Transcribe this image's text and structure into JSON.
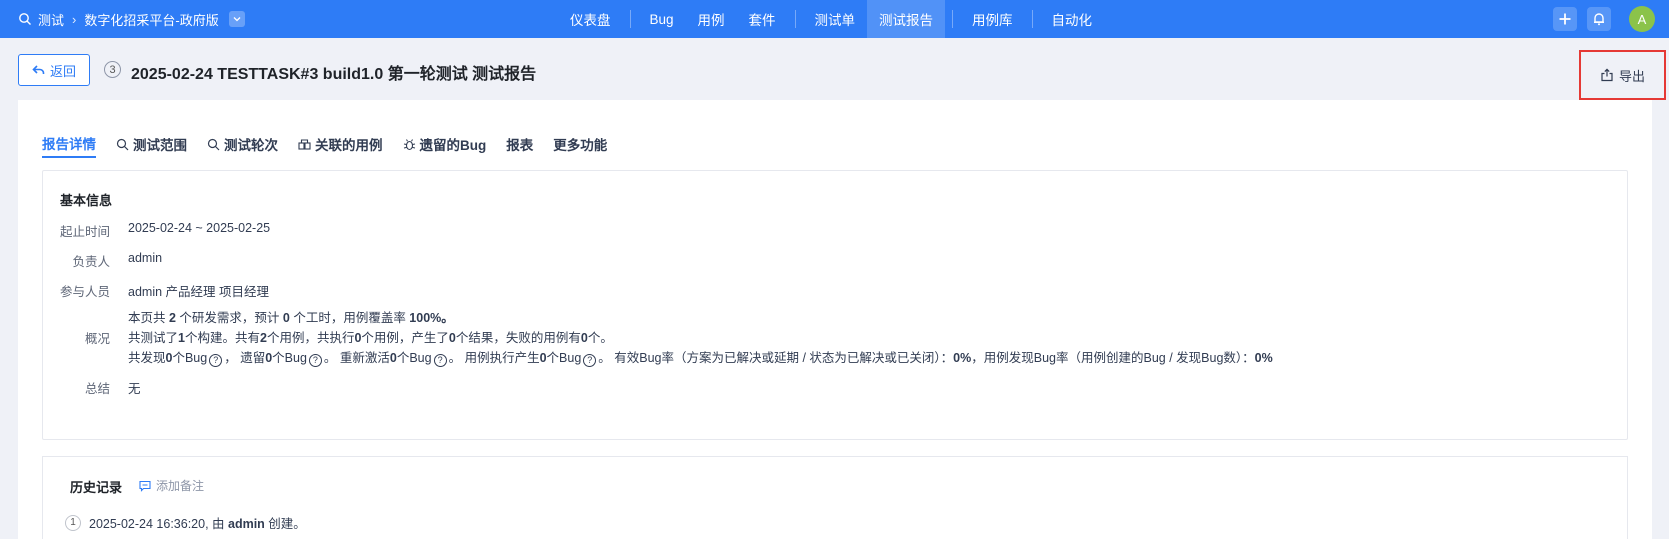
{
  "breadcrumb": {
    "module": "测试",
    "product": "数字化招采平台-政府版"
  },
  "nav": {
    "items": [
      {
        "label": "仪表盘"
      },
      {
        "label": "Bug"
      },
      {
        "label": "用例"
      },
      {
        "label": "套件"
      },
      {
        "label": "测试单"
      },
      {
        "label": "测试报告",
        "active": true
      },
      {
        "label": "用例库"
      },
      {
        "label": "自动化"
      }
    ]
  },
  "user": {
    "avatar_initial": "A"
  },
  "header": {
    "back_label": "返回",
    "report_id": "3",
    "title": "2025-02-24 TESTTASK#3 build1.0 第一轮测试 测试报告",
    "export_label": "导出"
  },
  "tabs": [
    {
      "label": "报告详情",
      "active": true,
      "icon": ""
    },
    {
      "label": "测试范围",
      "icon": "search-icon"
    },
    {
      "label": "测试轮次",
      "icon": "search-icon"
    },
    {
      "label": "关联的用例",
      "icon": "cases-icon"
    },
    {
      "label": "遗留的Bug",
      "icon": "bug-icon"
    },
    {
      "label": "报表",
      "icon": ""
    },
    {
      "label": "更多功能",
      "icon": ""
    }
  ],
  "basic_info": {
    "title": "基本信息",
    "period_label": "起止时间",
    "period_value": "2025-02-24 ~ 2025-02-25",
    "owner_label": "负责人",
    "owner_value": "admin",
    "members_label": "参与人员",
    "members_value": "admin 产品经理 项目经理",
    "overview_label": "概况",
    "overview": {
      "l1_a": "本页共 ",
      "l1_stories": "2",
      "l1_b": " 个研发需求，预计 ",
      "l1_hours": "0",
      "l1_c": " 个工时，用例覆盖率 ",
      "l1_coverage": "100%。",
      "l2_a": "共测试了",
      "l2_builds": "1",
      "l2_b": "个构建。共有",
      "l2_cases": "2",
      "l2_c": "个用例，共执行",
      "l2_runs": "0",
      "l2_d": "个用例，产生了",
      "l2_results": "0",
      "l2_e": "个结果，失败的用例有",
      "l2_failed": "0",
      "l2_f": "个。",
      "l3_found_a": "共发现",
      "l3_found": "0",
      "l3_found_b": "个Bug",
      "l3_legacy_a": "， 遗留",
      "l3_legacy": "0",
      "l3_legacy_b": "个Bug",
      "l3_reopen_a": "。 重新激活",
      "l3_reopen": "0",
      "l3_reopen_b": "个Bug",
      "l3_case_a": "。 用例执行产生",
      "l3_case": "0",
      "l3_case_b": "个Bug",
      "l3_eff_a": "。 有效Bug率（方案为已解决或延期 / 状态为已解决或已关闭）：",
      "l3_eff": "0%",
      "l3_disc_a": "，用例发现Bug率（用例创建的Bug / 发现Bug数）：",
      "l3_disc": "0%"
    },
    "summary_label": "总结",
    "summary_value": "无"
  },
  "history": {
    "title": "历史记录",
    "add_note_label": "添加备注",
    "entries": [
      {
        "index": "1",
        "time": "2025-02-24 16:36:20, 由 ",
        "user": "admin",
        "action": " 创建。"
      }
    ]
  },
  "colors": {
    "primary": "#2e7cf6",
    "highlight_border": "#e53935",
    "avatar": "#8bc34a"
  }
}
